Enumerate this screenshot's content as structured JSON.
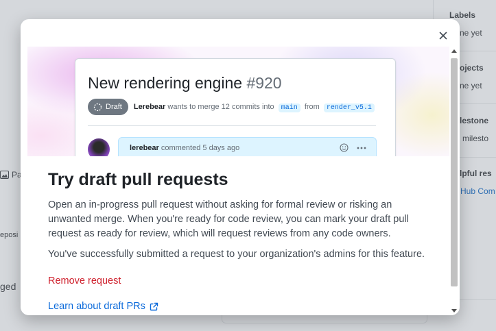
{
  "background": {
    "sidebar": {
      "labels_heading": "Labels",
      "labels_value": "ne yet",
      "projects_heading": "ojects",
      "projects_value": "ne yet",
      "milestone_heading": "lestone",
      "milestone_value": "milesto",
      "helpful_heading": "lpful res",
      "helpful_link": "Hub Com"
    },
    "left_fragments": {
      "pa": "Pa",
      "reposi": "eposi",
      "merged": "ged"
    }
  },
  "dialog": {
    "close_label": "close-icon",
    "illustration": {
      "pr_title": "New rendering engine",
      "pr_number": "#920",
      "draft_label": "Draft",
      "author": "Lerebear",
      "merge_text": "wants to merge 12 commits into",
      "base_branch": "main",
      "from_text": "from",
      "head_branch": "render_v5.1",
      "comment_author": "lerebear",
      "comment_meta": "commented 5 days ago"
    },
    "heading": "Try draft pull requests",
    "description": "Open an in-progress pull request without asking for formal review or risking an unwanted merge. When you're ready for code review, you can mark your draft pull request as ready for review, which will request reviews from any code owners.",
    "submitted_text": "You've successfully submitted a request to your organization's admins for this feature.",
    "remove_request": "Remove request",
    "learn_link": "Learn about draft PRs"
  },
  "colors": {
    "accent_link": "#0969da",
    "danger": "#cf222e",
    "draft_badge": "#6e7781",
    "heading_text": "#1f2328"
  }
}
